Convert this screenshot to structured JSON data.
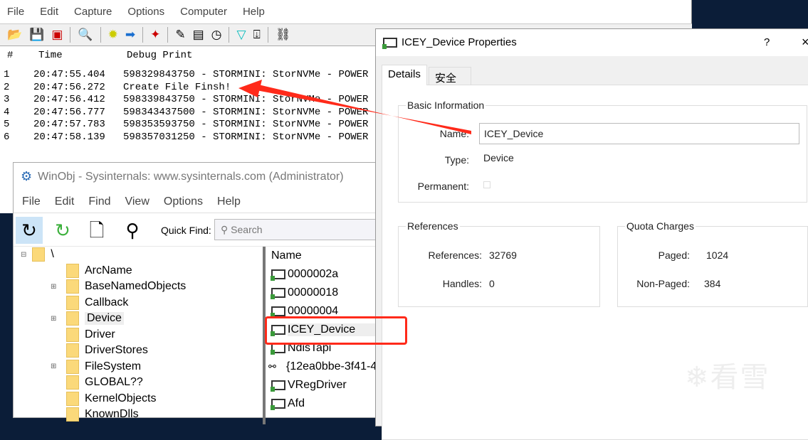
{
  "debugview": {
    "menu": [
      "File",
      "Edit",
      "Capture",
      "Options",
      "Computer",
      "Help"
    ],
    "toolbar_icons": [
      "open-icon",
      "save-icon",
      "clear-icon",
      "find-icon",
      "capture-icon",
      "autoscroll-icon",
      "highlight-icon",
      "edit-filter-icon",
      "clock-time-icon",
      "history-icon",
      "filter-icon",
      "scroll-icon",
      "binoculars-icon"
    ],
    "columns": [
      "#",
      "Time",
      "Debug Print"
    ],
    "rows": [
      {
        "n": "1",
        "time": "20:47:55.404",
        "msg": "598329843750 - STORMINI: StorNVMe - POWER"
      },
      {
        "n": "2",
        "time": "20:47:56.272",
        "msg": "Create File Finsh!"
      },
      {
        "n": "3",
        "time": "20:47:56.412",
        "msg": "598339843750 - STORMINI: StorNVMe - POWER"
      },
      {
        "n": "4",
        "time": "20:47:56.777",
        "msg": "598343437500 - STORMINI: StorNVMe - POWER"
      },
      {
        "n": "5",
        "time": "20:47:57.783",
        "msg": "598353593750 - STORMINI: StorNVMe - POWER"
      },
      {
        "n": "6",
        "time": "20:47:58.139",
        "msg": "598357031250 - STORMINI: StorNVMe - POWER"
      }
    ]
  },
  "winobj": {
    "title": "WinObj - Sysinternals: www.sysinternals.com (Administrator)",
    "menu": [
      "File",
      "Edit",
      "Find",
      "View",
      "Options",
      "Help"
    ],
    "quick_find_label": "Quick Find:",
    "search_placeholder": "Search",
    "tree_root": "\\",
    "tree": [
      "ArcName",
      "BaseNamedObjects",
      "Callback",
      "Device",
      "Driver",
      "DriverStores",
      "FileSystem",
      "GLOBAL??",
      "KernelObjects",
      "KnownDlls"
    ],
    "selected_tree": "Device",
    "list_header": "Name",
    "list": [
      "0000002a",
      "00000018",
      "00000004",
      "ICEY_Device",
      "NdisTapi",
      "{12ea0bbe-3f41-4",
      "VRegDriver",
      "Afd"
    ],
    "selected_item": "ICEY_Device"
  },
  "dialog": {
    "title": "ICEY_Device Properties",
    "help": "?",
    "close": "×",
    "tabs": [
      "Details",
      "安全"
    ],
    "basic": {
      "legend": "Basic Information",
      "name_label": "Name:",
      "name_value": "ICEY_Device",
      "type_label": "Type:",
      "type_value": "Device",
      "permanent_label": "Permanent:"
    },
    "refs": {
      "legend": "References",
      "references_label": "References:",
      "references_value": "32769",
      "handles_label": "Handles:",
      "handles_value": "0"
    },
    "quota": {
      "legend": "Quota Charges",
      "paged_label": "Paged:",
      "paged_value": "1024",
      "nonpaged_label": "Non-Paged:",
      "nonpaged_value": "384"
    }
  },
  "watermark": "看雪",
  "colors": {
    "annotation": "#ff2a1a",
    "desktop": "#0b1d38"
  }
}
